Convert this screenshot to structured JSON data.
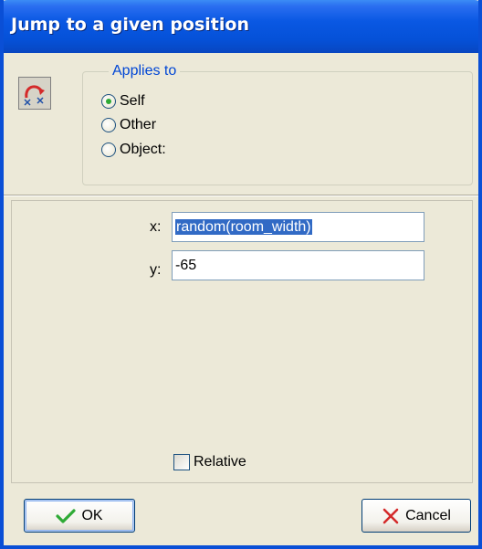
{
  "window": {
    "title": "Jump to a given position"
  },
  "applies_to": {
    "legend": "Applies to",
    "options": [
      {
        "label": "Self",
        "checked": true
      },
      {
        "label": "Other",
        "checked": false
      },
      {
        "label": "Object:",
        "checked": false
      }
    ]
  },
  "fields": {
    "x": {
      "label": "x:",
      "value": "random(room_width)",
      "selected": true
    },
    "y": {
      "label": "y:",
      "value": "-65"
    }
  },
  "relative": {
    "label": "Relative",
    "checked": false
  },
  "buttons": {
    "ok": {
      "label": "OK",
      "icon": "checkmark-icon",
      "icon_color": "#2eaa35"
    },
    "cancel": {
      "label": "Cancel",
      "icon": "x-icon",
      "icon_color": "#d42a2a"
    }
  },
  "icons": {
    "action": "jump-to-position-icon"
  },
  "colors": {
    "titlebar": "#0a58e3",
    "dialog_bg": "#ece9d8",
    "legend_text": "#0046d5",
    "selection": "#316ac5"
  }
}
